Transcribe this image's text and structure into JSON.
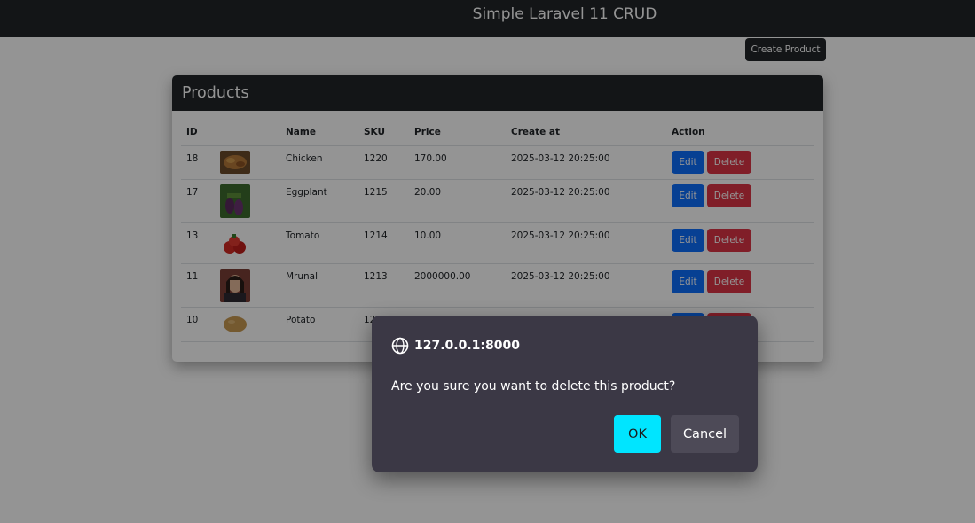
{
  "navbar": {
    "title": "Simple Laravel 11 CRUD"
  },
  "toolbar": {
    "create_label": "Create Product"
  },
  "card": {
    "title": "Products"
  },
  "table": {
    "headers": {
      "id": "ID",
      "name": "Name",
      "sku": "SKU",
      "price": "Price",
      "created": "Create at",
      "action": "Action"
    },
    "rows": [
      {
        "id": "18",
        "name": "Chicken",
        "sku": "1220",
        "price": "170.00",
        "created": "2025-03-12 20:25:00",
        "edit": "Edit",
        "delete": "Delete",
        "image": "chicken-thumbnail"
      },
      {
        "id": "17",
        "name": "Eggplant",
        "sku": "1215",
        "price": "20.00",
        "created": "2025-03-12 20:25:00",
        "edit": "Edit",
        "delete": "Delete",
        "image": "eggplant-thumbnail"
      },
      {
        "id": "13",
        "name": "Tomato",
        "sku": "1214",
        "price": "10.00",
        "created": "2025-03-12 20:25:00",
        "edit": "Edit",
        "delete": "Delete",
        "image": "tomato-thumbnail"
      },
      {
        "id": "11",
        "name": "Mrunal",
        "sku": "1213",
        "price": "2000000.00",
        "created": "2025-03-12 20:25:00",
        "edit": "Edit",
        "delete": "Delete",
        "image": "person-thumbnail"
      },
      {
        "id": "10",
        "name": "Potato",
        "sku": "12",
        "price": "",
        "created": "",
        "edit": "",
        "delete": "",
        "image": "potato-thumbnail"
      }
    ]
  },
  "dialog": {
    "origin": "127.0.0.1:8000",
    "message": "Are you sure you want to delete this product?",
    "ok_label": "OK",
    "cancel_label": "Cancel",
    "icon": "globe-icon"
  },
  "colors": {
    "navbar": "#212529",
    "edit_button": "#0d6efd",
    "delete_button": "#dc3545",
    "ok_button": "#00e5ff",
    "dialog_bg": "#3b3845"
  }
}
